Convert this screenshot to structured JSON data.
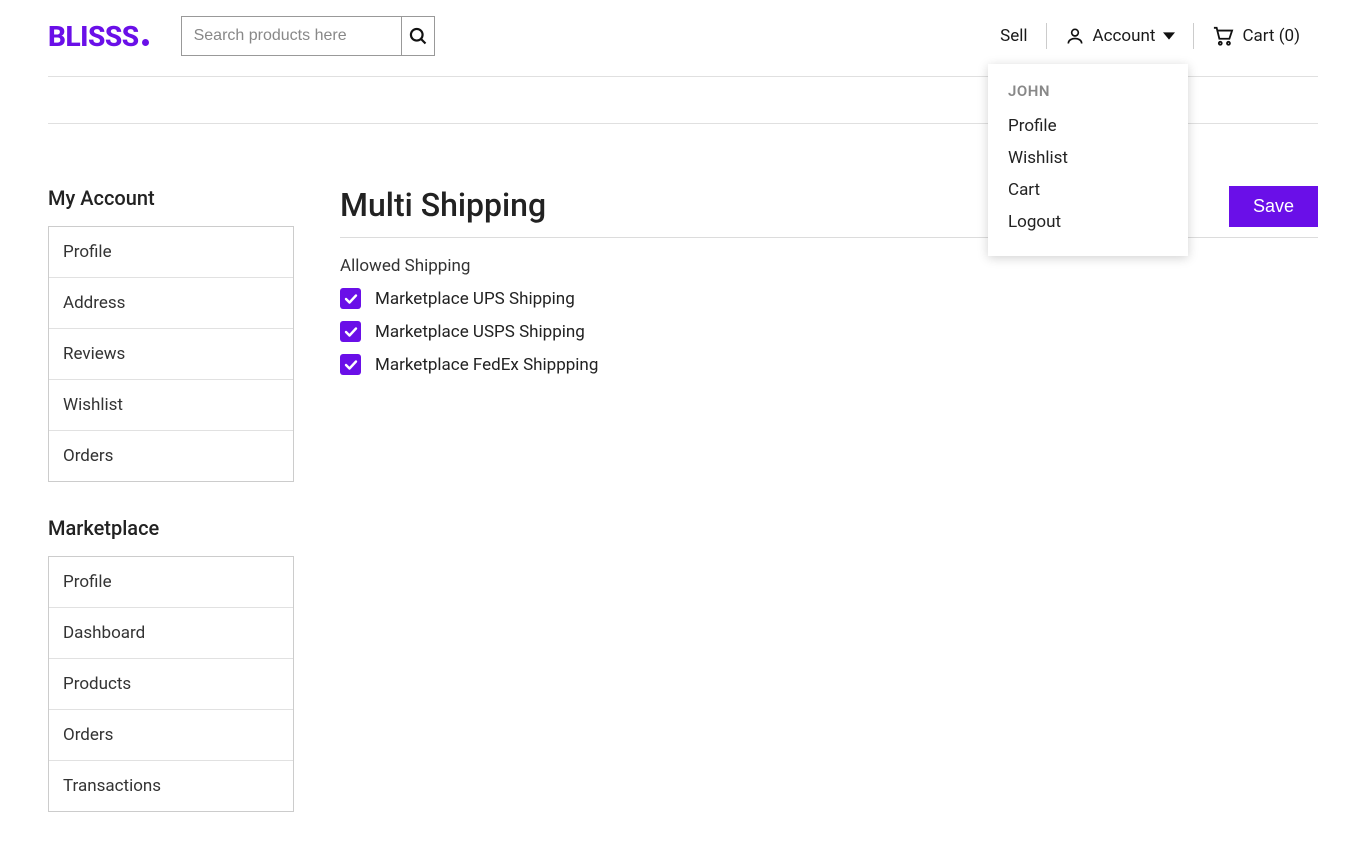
{
  "brand": "BLISSS",
  "search": {
    "placeholder": "Search products here"
  },
  "header": {
    "sell": "Sell",
    "account": "Account",
    "cart_label": "Cart (0)"
  },
  "account_menu": {
    "user": "JOHN",
    "items": [
      "Profile",
      "Wishlist",
      "Cart",
      "Logout"
    ]
  },
  "sidebar": {
    "groups": [
      {
        "heading": "My Account",
        "items": [
          "Profile",
          "Address",
          "Reviews",
          "Wishlist",
          "Orders"
        ]
      },
      {
        "heading": "Marketplace",
        "items": [
          "Profile",
          "Dashboard",
          "Products",
          "Orders",
          "Transactions"
        ]
      }
    ]
  },
  "main": {
    "title": "Multi Shipping",
    "save": "Save",
    "allowed_label": "Allowed Shipping",
    "options": [
      {
        "label": "Marketplace UPS Shipping",
        "checked": true
      },
      {
        "label": "Marketplace USPS Shipping",
        "checked": true
      },
      {
        "label": "Marketplace FedEx Shippping",
        "checked": true
      }
    ]
  },
  "colors": {
    "accent": "#6a0fe8"
  }
}
